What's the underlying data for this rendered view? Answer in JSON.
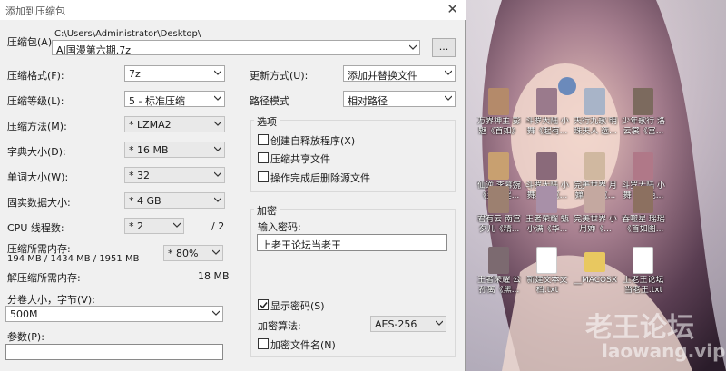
{
  "dialog": {
    "title": "添加到压缩包",
    "close_glyph": "✕",
    "archive_label": "压缩包(A)",
    "archive_path": "C:\\Users\\Administrator\\Desktop\\",
    "archive_name": "AI国漫第六期.7z",
    "browse_label": "...",
    "format": {
      "label": "压缩格式(F):",
      "value": "7z"
    },
    "level": {
      "label": "压缩等级(L):",
      "value": "5 - 标准压缩"
    },
    "method": {
      "label": "压缩方法(M):",
      "value": "* LZMA2"
    },
    "dict": {
      "label": "字典大小(D):",
      "value": "* 16 MB"
    },
    "word": {
      "label": "单词大小(W):",
      "value": "* 32"
    },
    "solid": {
      "label": "固实数据大小:",
      "value": "* 4 GB"
    },
    "threads": {
      "label": "CPU 线程数:",
      "value": "* 2",
      "max": "/ 2"
    },
    "memory": {
      "label": "压缩所需内存:",
      "values": "194 MB / 1434 MB / 1951 MB",
      "percent": "* 80%"
    },
    "decomp_memory": {
      "label": "解压缩所需内存:",
      "value": "18 MB"
    },
    "volume": {
      "label": "分卷大小，字节(V):",
      "value": "500M"
    },
    "params": {
      "label": "参数(P):",
      "value": ""
    },
    "update_mode": {
      "label": "更新方式(U):",
      "value": "添加并替换文件"
    },
    "path_mode": {
      "label": "路径模式",
      "value": "相对路径"
    },
    "options": {
      "title": "选项",
      "items": [
        {
          "label": "创建自释放程序(X)",
          "checked": false
        },
        {
          "label": "压缩共享文件",
          "checked": false
        },
        {
          "label": "操作完成后删除源文件",
          "checked": false
        }
      ]
    },
    "encryption": {
      "title": "加密",
      "password_label": "输入密码:",
      "password_value": "上老王论坛当老王",
      "show_password": {
        "label": "显示密码(S)",
        "checked": true
      },
      "method_label": "加密算法:",
      "method_value": "AES-256",
      "encrypt_names": {
        "label": "加密文件名(N)",
        "checked": false
      }
    }
  },
  "desktop": {
    "icons": [
      {
        "label1": "万界神主  彭",
        "label2": "魅《首如》",
        "color": "#b48a6a"
      },
      {
        "label1": "斗罗大陆 小",
        "label2": "舞《起有...",
        "color": "#9a7a8c"
      },
      {
        "label1": "天行九歌 明",
        "label2": "珠夫人 选...",
        "color": "#a8b4c8"
      },
      {
        "label1": "少年歌行 洛",
        "label2": "云裳《宫...",
        "color": "#7c6a5e"
      },
      {
        "label1": "仙逆  李慕婉",
        "label2": "《盘色淫...",
        "color": "#c8a070"
      },
      {
        "label1": "斗罗大陆 小",
        "label2": "舞黑丝《...",
        "color": "#8a6a7a"
      },
      {
        "label1": "完美世界  月",
        "label2": "婵仙子《...",
        "color": "#d0b8a0"
      },
      {
        "label1": "斗罗大陆 小",
        "label2": "舞《粉色...",
        "color": "#b07888"
      },
      {
        "label1": "君有云  南宫",
        "label2": "夕儿《精...",
        "color": "#9c8070"
      },
      {
        "label1": "王者荣耀 甄",
        "label2": "小满《华...",
        "color": "#a890a8"
      },
      {
        "label1": "完美世界 小",
        "label2": "月婵《...",
        "color": "#c4a8a0"
      },
      {
        "label1": "吞噬星  瑶瑶",
        "label2": "《首如图...",
        "color": "#8c7060"
      },
      {
        "label1": "王者荣耀  公",
        "label2": "孙离《黑...",
        "color": "#7c6a70"
      },
      {
        "label1": "新建文本文",
        "label2": "档.txt",
        "color": "#ffffff"
      },
      {
        "label1": "__MACOSX",
        "label2": "",
        "color": "#e8c860"
      },
      {
        "label1": "上老王论坛",
        "label2": "当老王.txt",
        "color": "#ffffff"
      }
    ],
    "watermark_text": "老王论坛",
    "watermark_url": "laowang.vip"
  }
}
